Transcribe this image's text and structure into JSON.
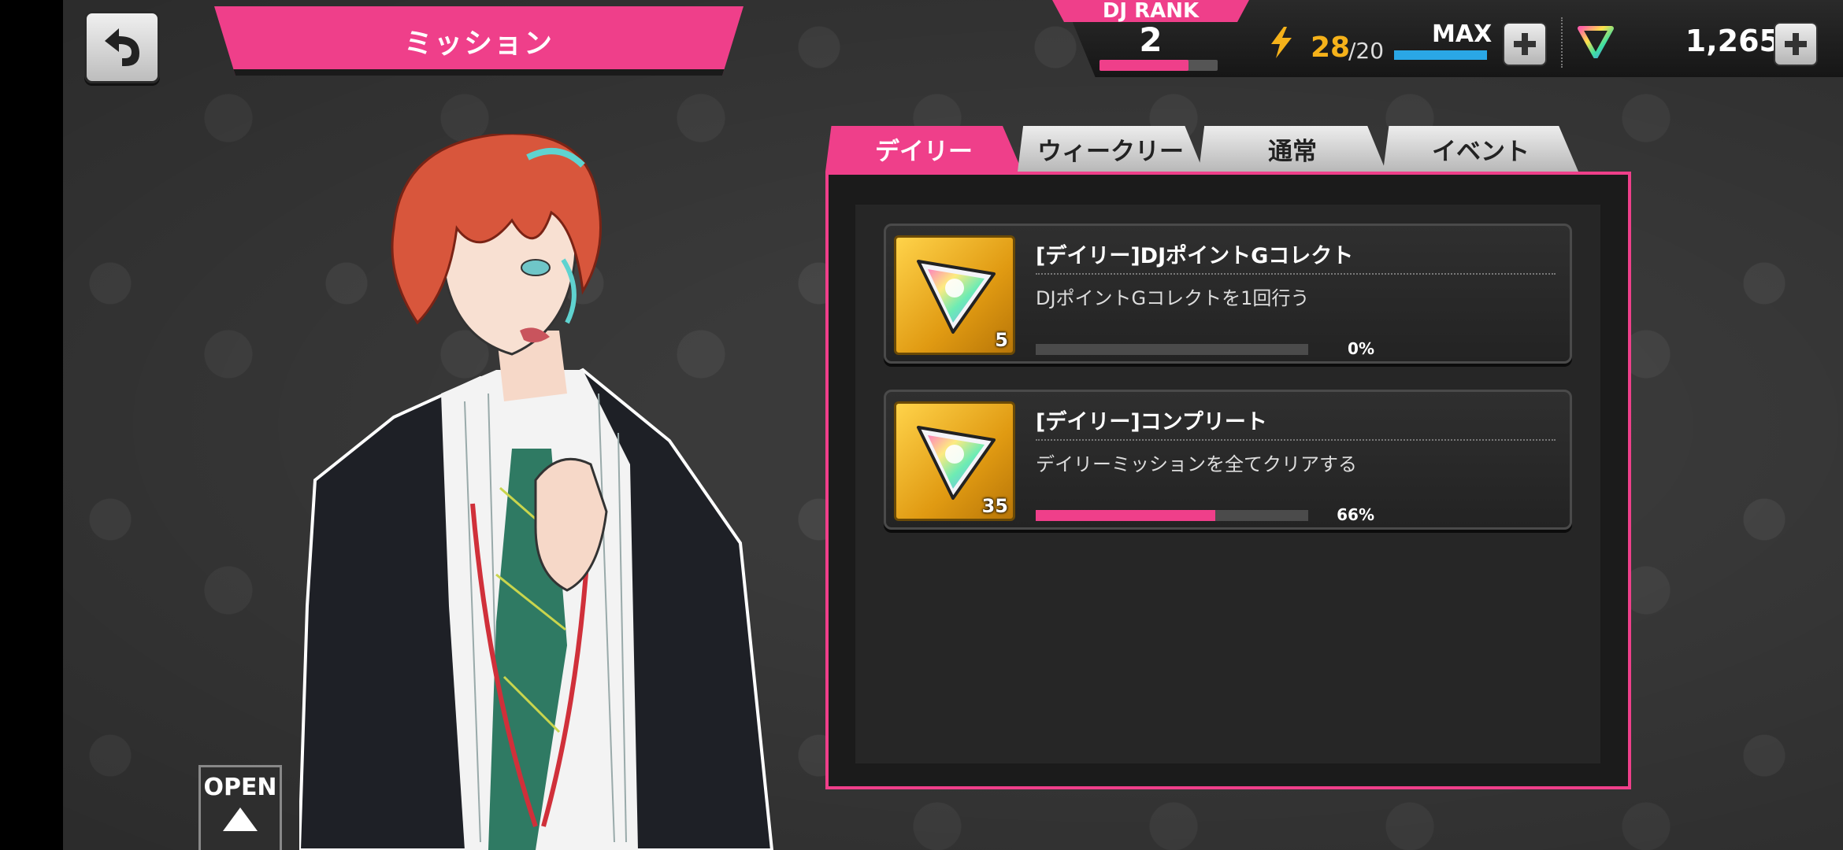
{
  "header": {
    "title": "ミッション",
    "dj_rank_label": "DJ RANK",
    "dj_rank_value": "2",
    "stamina_current": "28",
    "stamina_max": "/20",
    "stamina_status": "MAX",
    "gems": "1,265"
  },
  "tabs": [
    {
      "label": "デイリー",
      "active": true
    },
    {
      "label": "ウィークリー",
      "active": false
    },
    {
      "label": "通常",
      "active": false
    },
    {
      "label": "イベント",
      "active": false
    }
  ],
  "missions": [
    {
      "title": "[デイリー]DJポイントGコレクト",
      "description": "DJポイントGコレクトを1回行う",
      "reward_count": "5",
      "progress_text": "0%",
      "progress": 0
    },
    {
      "title": "[デイリー]コンプリート",
      "description": "デイリーミッションを全てクリアする",
      "reward_count": "35",
      "progress_text": "66%",
      "progress": 0.66
    }
  ],
  "open_button": "OPEN",
  "colors": {
    "accent": "#ef3f8a",
    "stamina": "#f5b21a",
    "stamina_bar": "#2aa7e6"
  },
  "icons": [
    "back-arrow-icon",
    "lightning-icon",
    "plus-icon",
    "gem-icon",
    "reward-gem-icon"
  ]
}
